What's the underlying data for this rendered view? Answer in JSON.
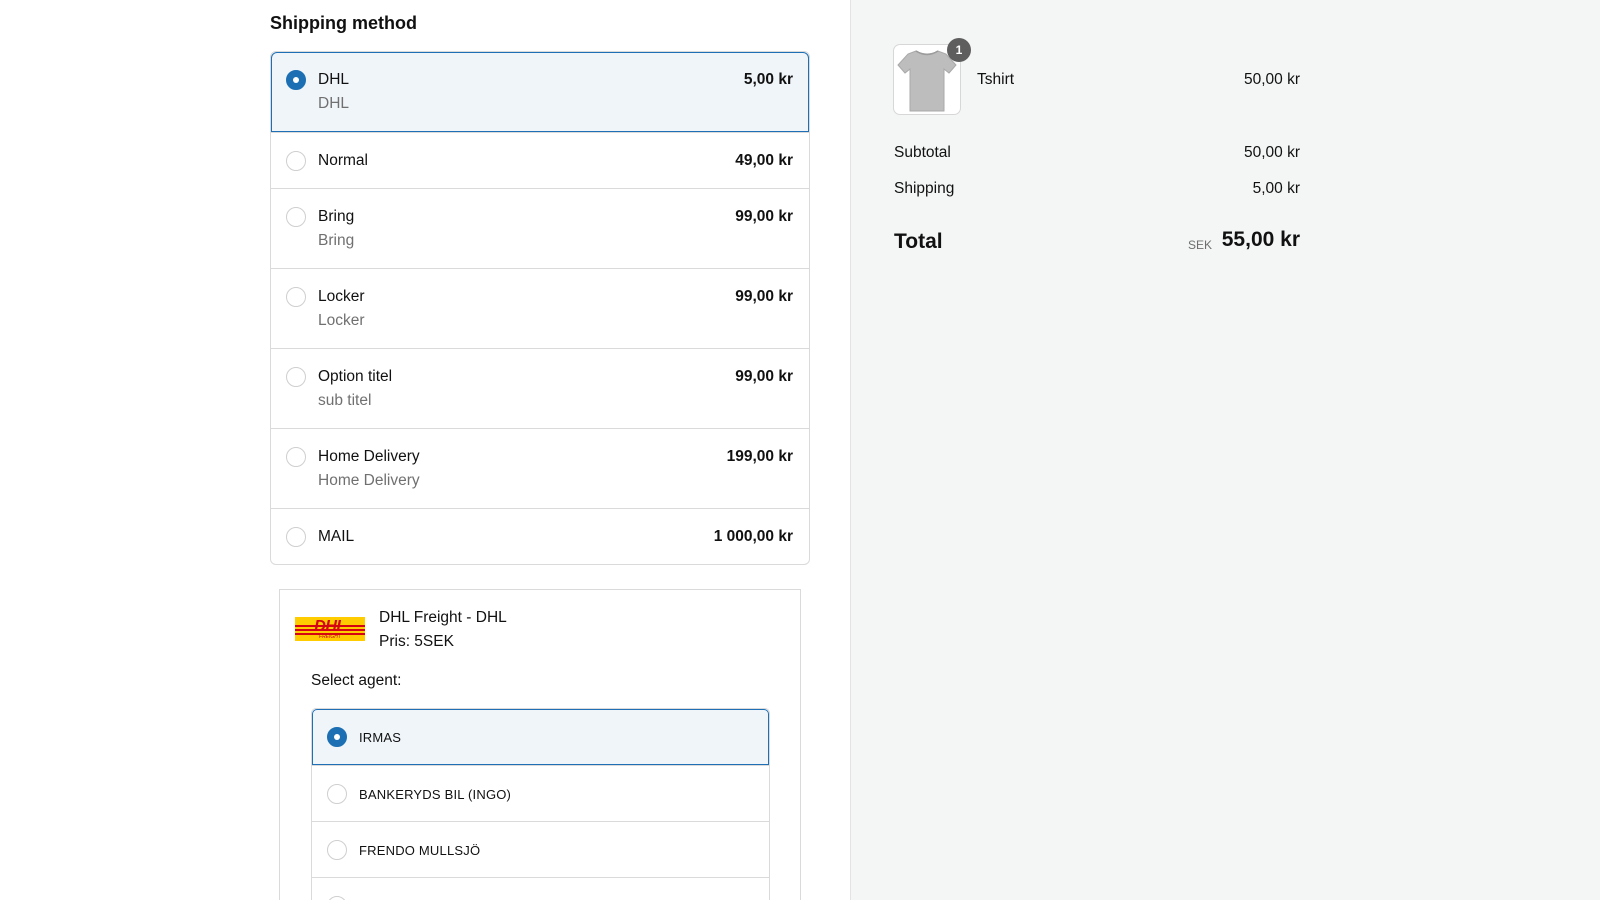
{
  "shipping": {
    "title": "Shipping method",
    "options": [
      {
        "name": "DHL",
        "sub": "DHL",
        "price": "5,00 kr",
        "selected": true
      },
      {
        "name": "Normal",
        "sub": "",
        "price": "49,00 kr",
        "selected": false
      },
      {
        "name": "Bring",
        "sub": "Bring",
        "price": "99,00 kr",
        "selected": false
      },
      {
        "name": "Locker",
        "sub": "Locker",
        "price": "99,00 kr",
        "selected": false
      },
      {
        "name": "Option titel",
        "sub": "sub titel",
        "price": "99,00 kr",
        "selected": false
      },
      {
        "name": "Home Delivery",
        "sub": "Home Delivery",
        "price": "199,00 kr",
        "selected": false
      },
      {
        "name": "MAIL",
        "sub": "",
        "price": "1 000,00 kr",
        "selected": false
      }
    ]
  },
  "agent_panel": {
    "logo_text": "DHL",
    "logo_subtext": "FREIGHT",
    "title": "DHL Freight - DHL",
    "price": "Pris: 5SEK",
    "select_label": "Select agent:",
    "agents": [
      {
        "name": "IRMAS",
        "selected": true
      },
      {
        "name": "BANKERYDS BIL (INGO)",
        "selected": false
      },
      {
        "name": "FRENDO MULLSJÖ",
        "selected": false
      },
      {
        "name": "",
        "selected": false
      }
    ]
  },
  "summary": {
    "product": {
      "name": "Tshirt",
      "price": "50,00 kr",
      "quantity": "1",
      "icon": "tshirt-image"
    },
    "subtotal_label": "Subtotal",
    "subtotal_value": "50,00 kr",
    "shipping_label": "Shipping",
    "shipping_value": "5,00 kr",
    "total_label": "Total",
    "total_currency": "SEK",
    "total_value": "55,00 kr"
  },
  "colors": {
    "accent": "#1c6fb3",
    "selected_bg": "#f0f5fa",
    "sidebar_bg": "#f4f5f5",
    "dhl_yellow": "#ffcc00",
    "dhl_red": "#d40511"
  }
}
